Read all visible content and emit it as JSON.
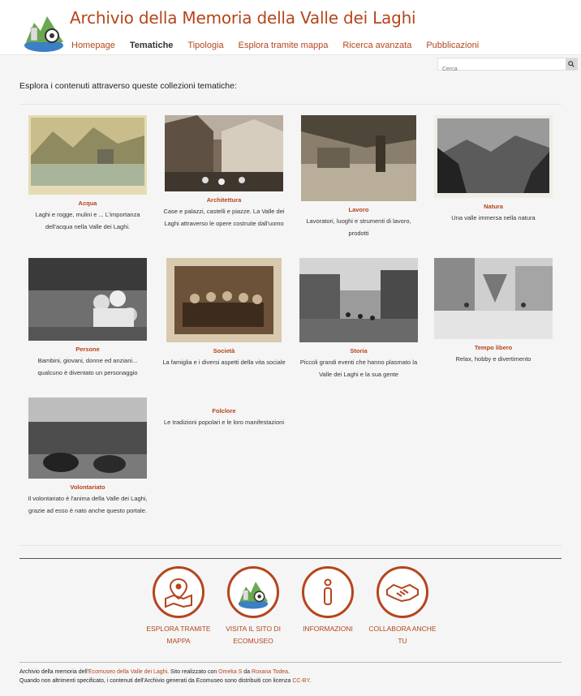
{
  "header": {
    "title": "Archivio della Memoria della Valle dei Laghi",
    "nav": [
      "Homepage",
      "Tematiche",
      "Tipologia",
      "Esplora tramite mappa",
      "Ricerca avanzata",
      "Pubblicazioni"
    ],
    "active_nav": "Tematiche"
  },
  "search": {
    "placeholder": "Cerca"
  },
  "intro": "Esplora i contenuti attraverso queste collezioni tematiche:",
  "collections": [
    {
      "title": "Acqua",
      "desc": "Laghi e rogge, mulini e ... L'importanza dell'acqua nella Valle dei Laghi."
    },
    {
      "title": "Architettura",
      "desc": "Case e palazzi, castelli e piazze. La Valle dei Laghi attraverso le opere costruite dall'uomo"
    },
    {
      "title": "Lavoro",
      "desc": "Lavoratori, luoghi e strumenti di lavoro, prodotti"
    },
    {
      "title": "Natura",
      "desc": "Una valle immersa nella natura"
    },
    {
      "title": "Persone",
      "desc": "Bambini, giovani, donne ed anziani... qualcuno è diventato un personaggio"
    },
    {
      "title": "Società",
      "desc": "La famiglia e i diversi aspetti della vita sociale"
    },
    {
      "title": "Storia",
      "desc": "Piccoli grandi eventi che hanno plasmato la Valle dei Laghi e la sua gente"
    },
    {
      "title": "Tempo libero",
      "desc": "Relax, hobby e divertimento"
    },
    {
      "title": "Volontariato",
      "desc": "Il volontariato è l'anima della Valle dei Laghi, grazie ad esso è nato anche questo portale."
    },
    {
      "title": "Folclore",
      "desc": "Le tradizioni popolari e le loro manifestazioni"
    }
  ],
  "footer_links": [
    {
      "label": "Esplora tramite mappa",
      "icon": "map-pin-icon"
    },
    {
      "label": "Visita il sito di Ecomuseo",
      "icon": "ecomuseo-logo-icon"
    },
    {
      "label": "Informazioni",
      "icon": "info-icon"
    },
    {
      "label": "Collabora anche tu",
      "icon": "handshake-icon"
    }
  ],
  "footer": {
    "line1_a": "Archivio della memoria dell'",
    "line1_link1": "Ecomuseo della Valle dei Laghi",
    "line1_b": ". Sito realizzato con ",
    "line1_link2": "Omeka S",
    "line1_c": " da ",
    "line1_link3": "Roxana Todea",
    "line1_d": ".",
    "line2_a": "Quando non altrimenti specificato, i contenuti dell'Archivio generati da Ecomuseo sono distribuiti con licenza ",
    "line2_link": "CC-BY",
    "line2_b": "."
  },
  "colors": {
    "accent": "#b5451b"
  }
}
